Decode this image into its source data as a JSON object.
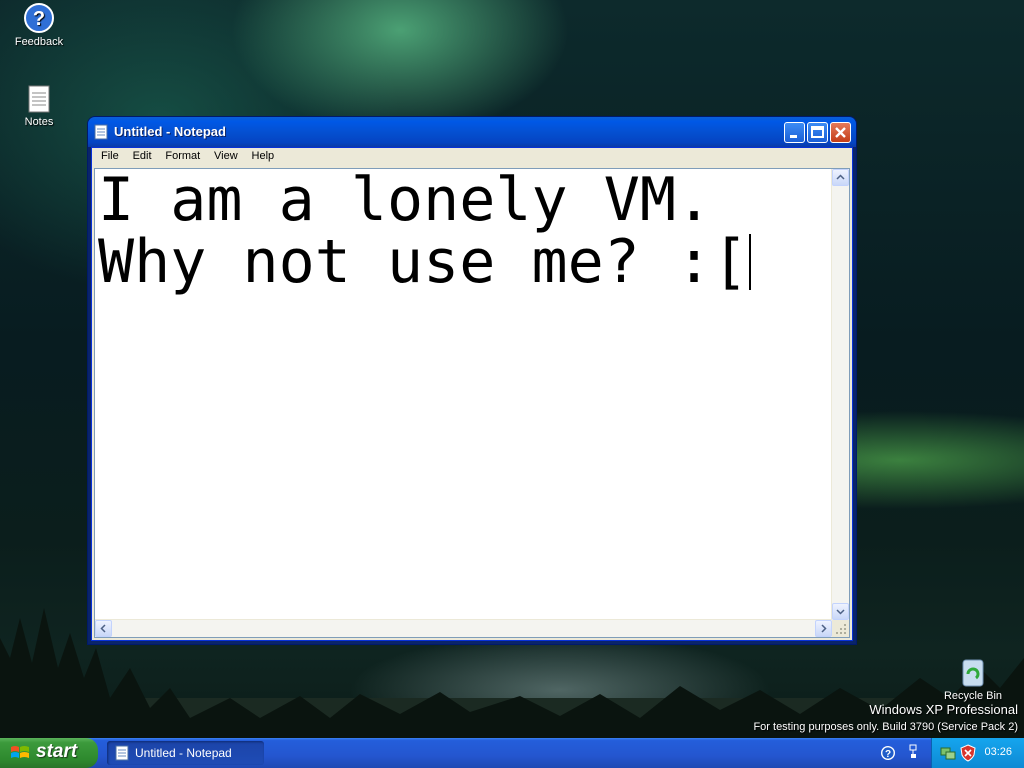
{
  "desktop": {
    "icons": [
      {
        "label": "Feedback",
        "icon": "help-icon"
      },
      {
        "label": "Notes",
        "icon": "notepad-file-icon"
      },
      {
        "label": "Recycle Bin",
        "icon": "recycle-bin-icon"
      }
    ],
    "watermark": {
      "edition": "Windows XP Professional",
      "build_line": "For testing purposes only. Build 3790 (Service Pack 2)"
    }
  },
  "window": {
    "title": "Untitled - Notepad",
    "controls": [
      "minimize",
      "maximize",
      "close"
    ],
    "menu": [
      "File",
      "Edit",
      "Format",
      "View",
      "Help"
    ],
    "document": {
      "line1": "I am a lonely VM.",
      "line2": "Why not use me? :["
    }
  },
  "taskbar": {
    "start_label": "start",
    "tasks": [
      {
        "label": "Untitled - Notepad"
      }
    ],
    "tray": {
      "clock": "03:26"
    }
  },
  "colors": {
    "taskbar_blue": "#245edb",
    "start_green": "#3c9a3c",
    "tray_blue": "#0e8ad4",
    "close_red": "#c43d17"
  }
}
